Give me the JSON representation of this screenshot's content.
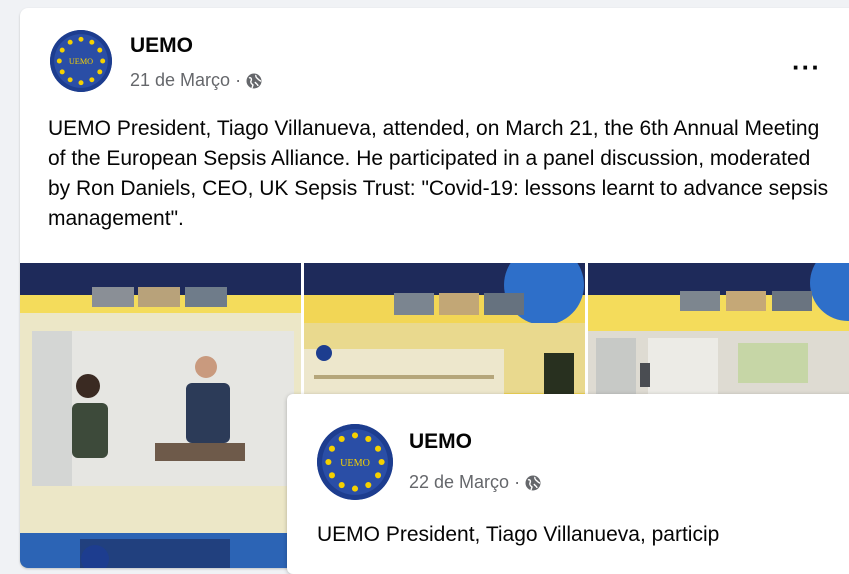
{
  "posts": [
    {
      "author": "UEMO",
      "date": "21 de Março",
      "separator": "·",
      "text": "UEMO President, Tiago Villanueva, attended, on March 21, the 6th Annual Meeting of the European Sepsis Alliance. He participated in a panel discussion, moderated by Ron Daniels, CEO, UK Sepsis Trust: \"Covid-19: lessons learnt to advance sepsis management\".",
      "more": "···",
      "avatar_text": "UEMO"
    },
    {
      "author": "UEMO",
      "date": "22 de Março",
      "separator": "·",
      "text": "UEMO President, Tiago Villanueva, particip",
      "avatar_text": "UEMO"
    }
  ],
  "colors": {
    "brand_blue": "#1d3d8f",
    "star_yellow": "#f5d100",
    "meta_gray": "#65676b",
    "photo_yellow": "#f4dc5b",
    "photo_navy": "#1e2a5a"
  },
  "icons": {
    "privacy": "globe-icon",
    "menu": "more-options-icon"
  }
}
